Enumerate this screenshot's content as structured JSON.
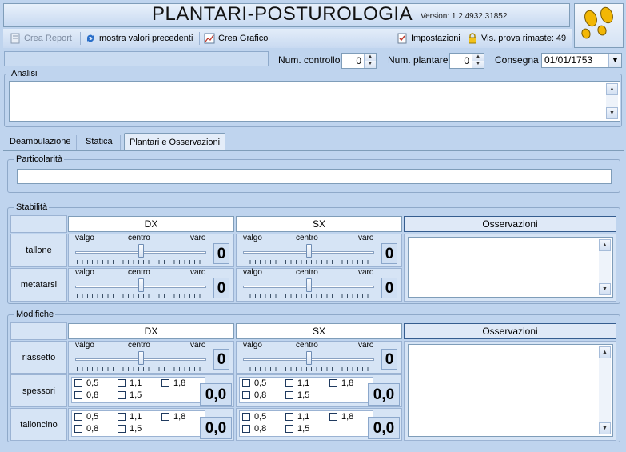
{
  "header": {
    "title": "PLANTARI-POSTUROLOGIA",
    "version": "Version: 1.2.4932.31852"
  },
  "toolbar": {
    "crea_report": "Crea Report",
    "mostra_valori": "mostra valori precedenti",
    "crea_grafico": "Crea Grafico",
    "impostazioni": "Impostazioni",
    "vis_prova": "Vis. prova rimaste: 49"
  },
  "controls": {
    "num_controllo_label": "Num. controllo",
    "num_controllo_value": "0",
    "num_plantare_label": "Num. plantare",
    "num_plantare_value": "0",
    "consegna_label": "Consegna",
    "consegna_value": "01/01/1753"
  },
  "analisi": {
    "title": "Analisi"
  },
  "tabs": [
    {
      "label": "Deambulazione"
    },
    {
      "label": "Statica"
    },
    {
      "label": "Plantari e Osservazioni"
    }
  ],
  "particolarita": {
    "title": "Particolarità"
  },
  "stabilita": {
    "title": "Stabilità",
    "col_dx": "DX",
    "col_sx": "SX",
    "col_obs": "Osservazioni",
    "rows": [
      {
        "label": "tallone",
        "dx_value": "0",
        "sx_value": "0"
      },
      {
        "label": "metatarsi",
        "dx_value": "0",
        "sx_value": "0"
      }
    ]
  },
  "slider_labels": {
    "left": "valgo",
    "center": "centro",
    "right": "varo"
  },
  "modifiche": {
    "title": "Modifiche",
    "col_dx": "DX",
    "col_sx": "SX",
    "col_obs": "Osservazioni",
    "riassetto": {
      "label": "riassetto",
      "dx_value": "0",
      "sx_value": "0"
    },
    "spessori": {
      "label": "spessori",
      "dx_value": "0,0",
      "sx_value": "0,0"
    },
    "talloncino": {
      "label": "talloncino",
      "dx_value": "0,0",
      "sx_value": "0,0"
    },
    "options": [
      "0,5",
      "1,1",
      "1,8",
      "0,8",
      "1,5"
    ]
  },
  "colors": {
    "background": "#bfd4ee",
    "accent_logo": "#f2b705"
  }
}
